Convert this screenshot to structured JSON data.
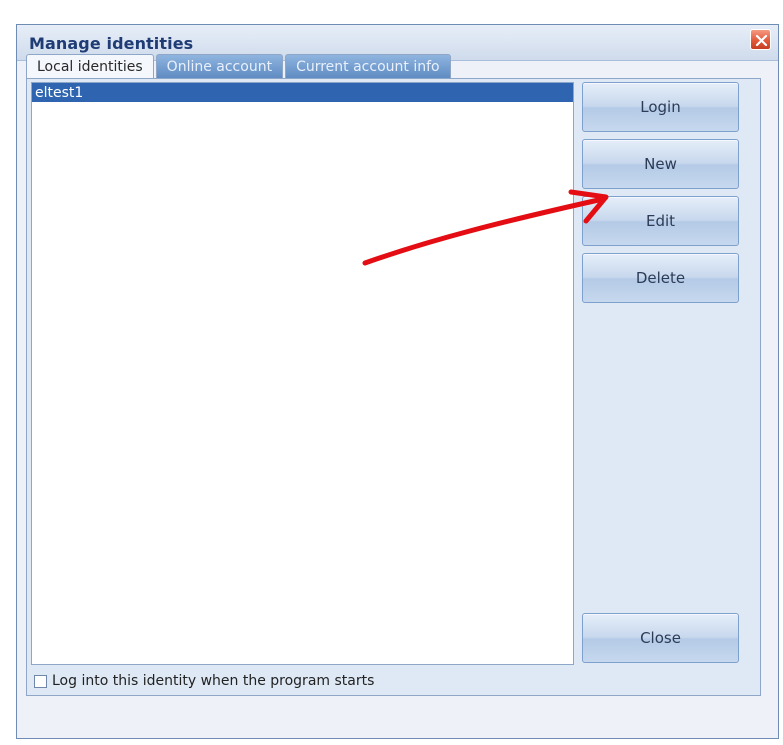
{
  "window": {
    "title": "Manage identities"
  },
  "tabs": [
    {
      "label": "Local identities",
      "active": true
    },
    {
      "label": "Online account",
      "active": false
    },
    {
      "label": "Current account info",
      "active": false
    }
  ],
  "identities": {
    "items": [
      "eltest1"
    ],
    "selected": "eltest1"
  },
  "buttons": {
    "login": "Login",
    "new": "New",
    "edit": "Edit",
    "delete": "Delete",
    "close": "Close"
  },
  "startup": {
    "label": "Log into this identity when the program starts",
    "checked": false
  },
  "annotation": {
    "color": "#e30d13",
    "target": "new-button"
  },
  "icons": {
    "close": "close-icon",
    "arrow": "red-arrow-annotation"
  },
  "colors": {
    "selection": "#2f65b0",
    "tab_inactive": "#6f97cc",
    "window_border": "#6f8cb5",
    "title_text": "#1f3c75"
  }
}
